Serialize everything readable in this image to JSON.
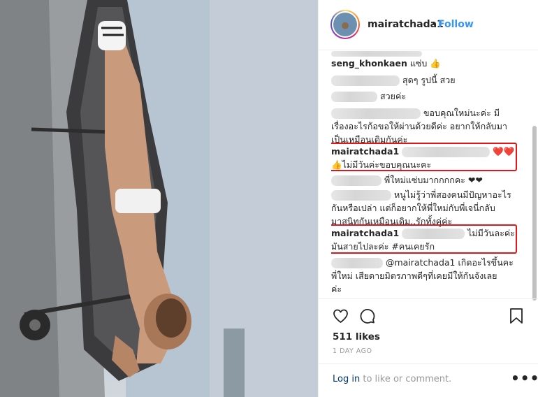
{
  "post_header": {
    "username": "mairatchada1",
    "separator": "•",
    "follow_label": "Follow"
  },
  "comments": [
    {
      "username": "",
      "text": "",
      "note": ""
    },
    {
      "username": "seng_khonkaen",
      "text": "แซ่บ 👍"
    },
    {
      "username": "",
      "text": "สุดๆ รูปนี้ สวย"
    },
    {
      "username": "",
      "text": "สวยค่ะ"
    },
    {
      "username": "",
      "text": "ขอบคุณใหม่นะค่ะ มีเรื่องอะไรก้อขอให้ผ่านด้วยดีค่ะ อยากให้กลับมาเป็นเหมือนเดิมกันค่ะ"
    },
    {
      "username": "mairatchada1",
      "text": "❤️❤️",
      "text2": "👍ไม่มีวันค่ะขอบคุณนะคะ"
    },
    {
      "username": "",
      "text": "พี่ใหม่แซ่บมากกกกคะ ❤❤"
    },
    {
      "username": "",
      "text": "หนูไม่รู้ว่าพี่สองคนมีปัญหาอะไรกันหรือเปล่า แต่ก็อยากให้พี่ใหม่กับพี่เจนี่กลับมาสนิทกันเหมือนเดิม..รักทั้งคู่ค่ะ"
    },
    {
      "username": "mairatchada1",
      "text": "ไม่มีวันละค่ะ",
      "text2": "มันสายไปละค่ะ #คนเคยรัก"
    },
    {
      "username": "",
      "text": "@mairatchada1 เกิดอะไรขึ้นคะพี่ใหม่ เสียดายมิตรภาพดีๆที่เคยมีให้กันจังเลยค่ะ"
    }
  ],
  "comment_lines": {
    "c4_line1": "ขอบคุณใหม่นะค่ะ มี",
    "c4_line2": "เรื่องอะไรก้อขอให้ผ่านด้วยดีค่ะ อยากให้กลับมา",
    "c4_line3": "เป็นเหมือนเดิมกันค่ะ",
    "c7_line1": "หนูไม่รู้ว่าพี่สองคนมีปัญหาอะไร",
    "c7_line2": "กันหรือเปล่า แต่ก็อยากให้พี่ใหม่กับพี่เจนี่กลับ",
    "c7_line3": "มาสนิทกันเหมือนเดิม..รักทั้งคู่ค่ะ",
    "c9_mention": "@mairatchada1",
    "c9_line1": "เกิดอะไรขึ้นคะ",
    "c9_line2": "พี่ใหม่ เสียดายมิตรภาพดีๆที่เคยมีให้กันจังเลย",
    "c9_line3": "ค่ะ"
  },
  "actions": {
    "likes": "511 likes",
    "age": "1 DAY AGO",
    "login_link": "Log in",
    "login_rest": "to like or comment.",
    "more": "•••"
  },
  "icons": [
    "heart-icon",
    "comment-icon",
    "bookmark-icon",
    "more-options-icon"
  ],
  "colors": {
    "link": "#3897f0",
    "highlight": "#e0161d",
    "text": "#262626",
    "muted": "#999999"
  }
}
